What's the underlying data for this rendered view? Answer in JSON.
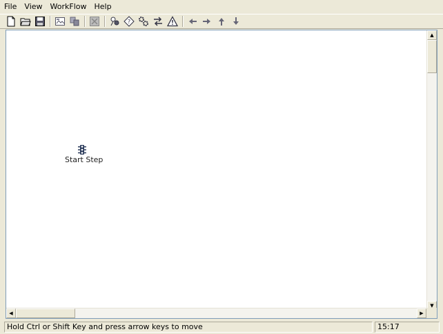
{
  "menubar": {
    "items": [
      {
        "label": "File"
      },
      {
        "label": "View"
      },
      {
        "label": "WorkFlow"
      },
      {
        "label": "Help"
      }
    ]
  },
  "toolbar": {
    "icons": [
      "new-file-icon",
      "open-folder-icon",
      "save-icon",
      "print-preview-icon",
      "copy-icon",
      "delete-icon",
      "add-step-icon",
      "validate-icon",
      "settings-icon",
      "transition-icon",
      "warning-icon",
      "arrow-left-icon",
      "arrow-right-icon",
      "arrow-up-icon",
      "arrow-down-icon"
    ]
  },
  "canvas": {
    "start_step_label": "Start Step"
  },
  "statusbar": {
    "message": "Hold Ctrl or Shift Key and press arrow keys to move",
    "time": "15:17"
  },
  "colors": {
    "chrome": "#ece9d8",
    "canvas": "#ffffff",
    "icon": "#3a4a6a"
  }
}
